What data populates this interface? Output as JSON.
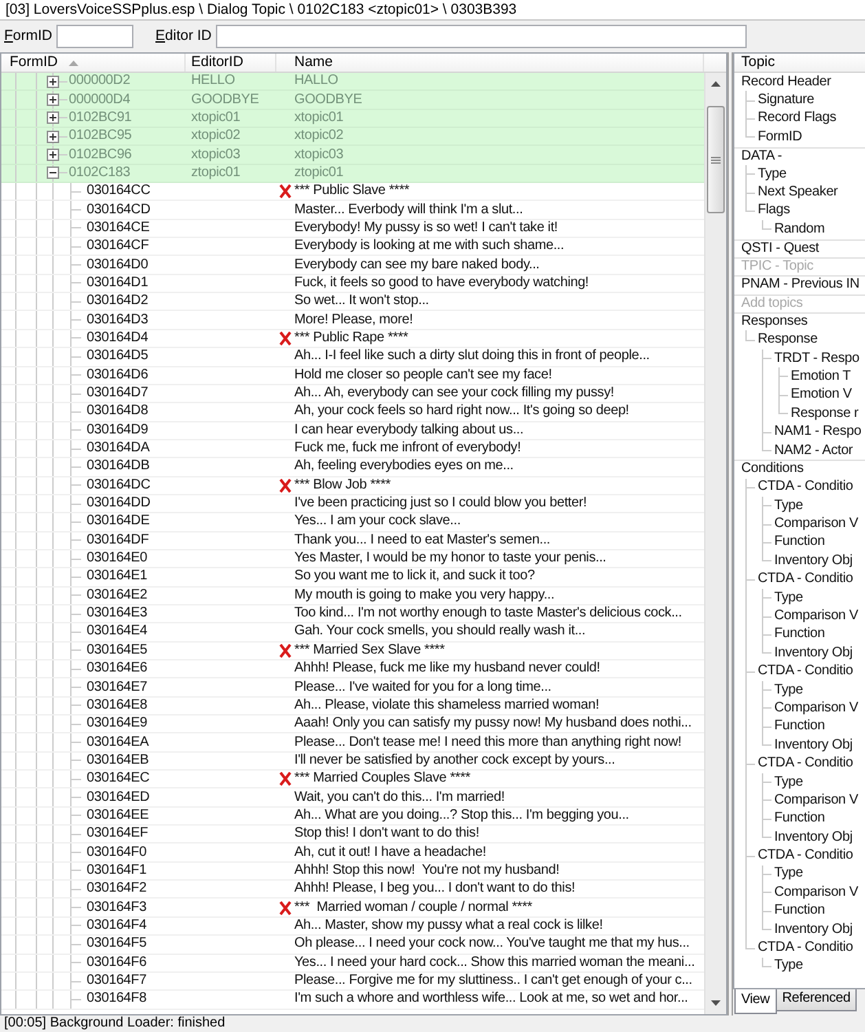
{
  "path_bar": {
    "text": "[03] LoversVoiceSSPplus.esp \\ Dialog Topic \\ 0102C183 <ztopic01> \\ 0303B393"
  },
  "filter": {
    "form_id": {
      "label": "FormID"
    },
    "editor_id": {
      "label": "Editor ID"
    }
  },
  "record_list": {
    "columns": [
      {
        "label": "FormID",
        "sorted": true
      },
      {
        "label": "EditorID",
        "sorted": false
      },
      {
        "label": "Name",
        "sorted": false
      }
    ],
    "rows": [
      {
        "form_id": "000000D2",
        "editor_id": "HELLO",
        "name": "HALLO",
        "expanded": false
      },
      {
        "form_id": "000000D4",
        "editor_id": "GOODBYE",
        "name": "GOODBYE",
        "expanded": false
      },
      {
        "form_id": "0102BC91",
        "editor_id": "xtopic01",
        "name": "xtopic01",
        "expanded": false
      },
      {
        "form_id": "0102BC95",
        "editor_id": "xtopic02",
        "name": "xtopic02",
        "expanded": false
      },
      {
        "form_id": "0102BC96",
        "editor_id": "xtopic03",
        "name": "xtopic03",
        "expanded": false
      },
      {
        "form_id": "0102C183",
        "editor_id": "ztopic01",
        "name": "ztopic01",
        "expanded": true,
        "children": [
          {
            "form_id": "030164CC",
            "name": "*** Public Slave ****",
            "marked": true
          },
          {
            "form_id": "030164CD",
            "name": "Master... Everbody will think I'm a slut...",
            "marked": false
          },
          {
            "form_id": "030164CE",
            "name": "Everybody! My pussy is so wet! I can't take it!",
            "marked": false
          },
          {
            "form_id": "030164CF",
            "name": "Everybody is looking at me with such shame...",
            "marked": false
          },
          {
            "form_id": "030164D0",
            "name": "Everybody can see my bare naked body...",
            "marked": false
          },
          {
            "form_id": "030164D1",
            "name": "Fuck, it feels so good to have everybody watching!",
            "marked": false
          },
          {
            "form_id": "030164D2",
            "name": "So wet... It won't stop...",
            "marked": false
          },
          {
            "form_id": "030164D3",
            "name": "More! Please, more!",
            "marked": false
          },
          {
            "form_id": "030164D4",
            "name": "*** Public Rape ****",
            "marked": true
          },
          {
            "form_id": "030164D5",
            "name": "Ah... I-I feel like such a dirty slut doing this in front of people...",
            "marked": false
          },
          {
            "form_id": "030164D6",
            "name": "Hold me closer so people can't see my face!",
            "marked": false
          },
          {
            "form_id": "030164D7",
            "name": "Ah... Ah, everybody can see your cock filling my pussy!",
            "marked": false
          },
          {
            "form_id": "030164D8",
            "name": "Ah, your cock feels so hard right now... It's going so deep!",
            "marked": false
          },
          {
            "form_id": "030164D9",
            "name": "I can hear everybody talking about us...",
            "marked": false
          },
          {
            "form_id": "030164DA",
            "name": "Fuck me, fuck me infront of everybody!",
            "marked": false
          },
          {
            "form_id": "030164DB",
            "name": "Ah, feeling everybodies eyes on me...",
            "marked": false
          },
          {
            "form_id": "030164DC",
            "name": "*** Blow Job ****",
            "marked": true
          },
          {
            "form_id": "030164DD",
            "name": "I've been practicing just so I could blow you better!",
            "marked": false
          },
          {
            "form_id": "030164DE",
            "name": "Yes... I am your cock slave...",
            "marked": false
          },
          {
            "form_id": "030164DF",
            "name": "Thank you... I need to eat Master's semen...",
            "marked": false
          },
          {
            "form_id": "030164E0",
            "name": "Yes Master, I would be my honor to taste your penis...",
            "marked": false
          },
          {
            "form_id": "030164E1",
            "name": "So you want me to lick it, and suck it too?",
            "marked": false
          },
          {
            "form_id": "030164E2",
            "name": "My mouth is going to make you very happy...",
            "marked": false
          },
          {
            "form_id": "030164E3",
            "name": "Too kind... I'm not worthy enough to taste Master's delicious cock...",
            "marked": false
          },
          {
            "form_id": "030164E4",
            "name": "Gah. Your cock smells, you should really wash it...",
            "marked": false
          },
          {
            "form_id": "030164E5",
            "name": "*** Married Sex Slave ****",
            "marked": true
          },
          {
            "form_id": "030164E6",
            "name": "Ahhh! Please, fuck me like my husband never could!",
            "marked": false
          },
          {
            "form_id": "030164E7",
            "name": "Please... I've waited for you for a long time...",
            "marked": false
          },
          {
            "form_id": "030164E8",
            "name": "Ah... Please, violate this shameless married woman!",
            "marked": false
          },
          {
            "form_id": "030164E9",
            "name": "Aaah! Only you can satisfy my pussy now! My husband does nothi...",
            "marked": false
          },
          {
            "form_id": "030164EA",
            "name": "Please... Don't tease me! I need this more than anything right now!",
            "marked": false
          },
          {
            "form_id": "030164EB",
            "name": "I'll never be satisfied by another cock except by yours...",
            "marked": false
          },
          {
            "form_id": "030164EC",
            "name": "*** Married Couples Slave ****",
            "marked": true
          },
          {
            "form_id": "030164ED",
            "name": "Wait, you can't do this... I'm married!",
            "marked": false
          },
          {
            "form_id": "030164EE",
            "name": "Ah... What are you doing...? Stop this... I'm begging you...",
            "marked": false
          },
          {
            "form_id": "030164EF",
            "name": "Stop this! I don't want to do this!",
            "marked": false
          },
          {
            "form_id": "030164F0",
            "name": "Ah, cut it out! I have a headache!",
            "marked": false
          },
          {
            "form_id": "030164F1",
            "name": "Ahhh! Stop this now!  You're not my husband!",
            "marked": false
          },
          {
            "form_id": "030164F2",
            "name": "Ahhh! Please, I beg you... I don't want to do this!",
            "marked": false
          },
          {
            "form_id": "030164F3",
            "name": "***  Married woman / couple / normal ****",
            "marked": true
          },
          {
            "form_id": "030164F4",
            "name": "Ah... Master, show my pussy what a real cock is lilke!",
            "marked": false
          },
          {
            "form_id": "030164F5",
            "name": "Oh please... I need your cock now... You've taught me that my hus...",
            "marked": false
          },
          {
            "form_id": "030164F6",
            "name": "Yes... I need your hard cock... Show this married woman the meani...",
            "marked": false
          },
          {
            "form_id": "030164F7",
            "name": "Please... Forgive me for my sluttiness.. I can't get enough of your c...",
            "marked": false
          },
          {
            "form_id": "030164F8",
            "name": "I'm such a whore and worthless wife... Look at me, so wet and hor...",
            "marked": false
          }
        ]
      }
    ]
  },
  "record_view": {
    "header": "Topic",
    "rows": [
      {
        "label": "Record Header",
        "disabled": false,
        "children": [
          {
            "label": "Signature"
          },
          {
            "label": "Record Flags"
          },
          {
            "label": "FormID"
          }
        ]
      },
      {
        "label": "DATA -",
        "disabled": false,
        "children": [
          {
            "label": "Type"
          },
          {
            "label": "Next Speaker"
          },
          {
            "label": "Flags",
            "children": [
              {
                "label": "Random"
              }
            ]
          }
        ]
      },
      {
        "label": "QSTI - Quest",
        "disabled": false
      },
      {
        "label": "TPIC - Topic",
        "disabled": true
      },
      {
        "label": "PNAM - Previous IN",
        "disabled": false
      },
      {
        "label": "Add topics",
        "disabled": true
      },
      {
        "label": "Responses",
        "disabled": false,
        "children": [
          {
            "label": "Response",
            "children": [
              {
                "label": "TRDT - Respo",
                "children": [
                  {
                    "label": "Emotion T"
                  },
                  {
                    "label": "Emotion V"
                  },
                  {
                    "label": "Response r"
                  }
                ]
              },
              {
                "label": "NAM1 - Respo"
              },
              {
                "label": "NAM2 - Actor"
              }
            ]
          }
        ]
      },
      {
        "label": "Conditions",
        "disabled": false,
        "children": [
          {
            "label": "CTDA - Conditio",
            "children": [
              {
                "label": "Type"
              },
              {
                "label": "Comparison V"
              },
              {
                "label": "Function"
              },
              {
                "label": "Inventory Obj"
              }
            ]
          },
          {
            "label": "CTDA - Conditio",
            "children": [
              {
                "label": "Type"
              },
              {
                "label": "Comparison V"
              },
              {
                "label": "Function"
              },
              {
                "label": "Inventory Obj"
              }
            ]
          },
          {
            "label": "CTDA - Conditio",
            "children": [
              {
                "label": "Type"
              },
              {
                "label": "Comparison V"
              },
              {
                "label": "Function"
              },
              {
                "label": "Inventory Obj"
              }
            ]
          },
          {
            "label": "CTDA - Conditio",
            "children": [
              {
                "label": "Type"
              },
              {
                "label": "Comparison V"
              },
              {
                "label": "Function"
              },
              {
                "label": "Inventory Obj"
              }
            ]
          },
          {
            "label": "CTDA - Conditio",
            "children": [
              {
                "label": "Type"
              },
              {
                "label": "Comparison V"
              },
              {
                "label": "Function"
              },
              {
                "label": "Inventory Obj"
              }
            ]
          },
          {
            "label": "CTDA - Conditio",
            "children": [
              {
                "label": "Type"
              }
            ]
          }
        ]
      }
    ],
    "tabs": [
      {
        "label": "View",
        "selected": true
      },
      {
        "label": "Referenced",
        "selected": false
      }
    ]
  },
  "status_bar": {
    "text": "[00:05] Background Loader: finished"
  }
}
